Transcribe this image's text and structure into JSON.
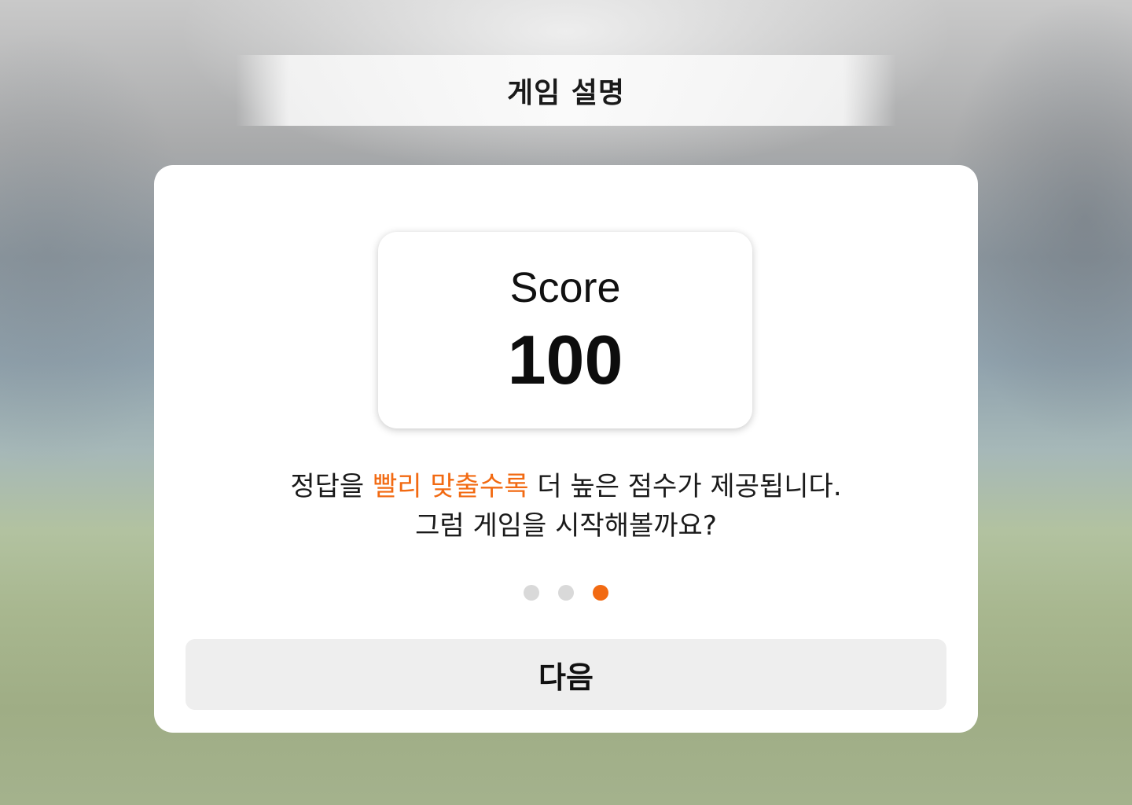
{
  "header": {
    "title": "게임 설명"
  },
  "score_card": {
    "label": "Score",
    "value": "100"
  },
  "description": {
    "line1_before": "정답을 ",
    "line1_highlight": "빨리 맞출수록",
    "line1_after": " 더 높은 점수가 제공됩니다.",
    "line2": "그럼 게임을 시작해볼까요?"
  },
  "pagination": {
    "total": 3,
    "current": 3
  },
  "actions": {
    "next_label": "다음"
  },
  "colors": {
    "accent": "#f26a12",
    "dot_inactive": "#d9d9d9",
    "button_bg": "#eeeeee"
  }
}
